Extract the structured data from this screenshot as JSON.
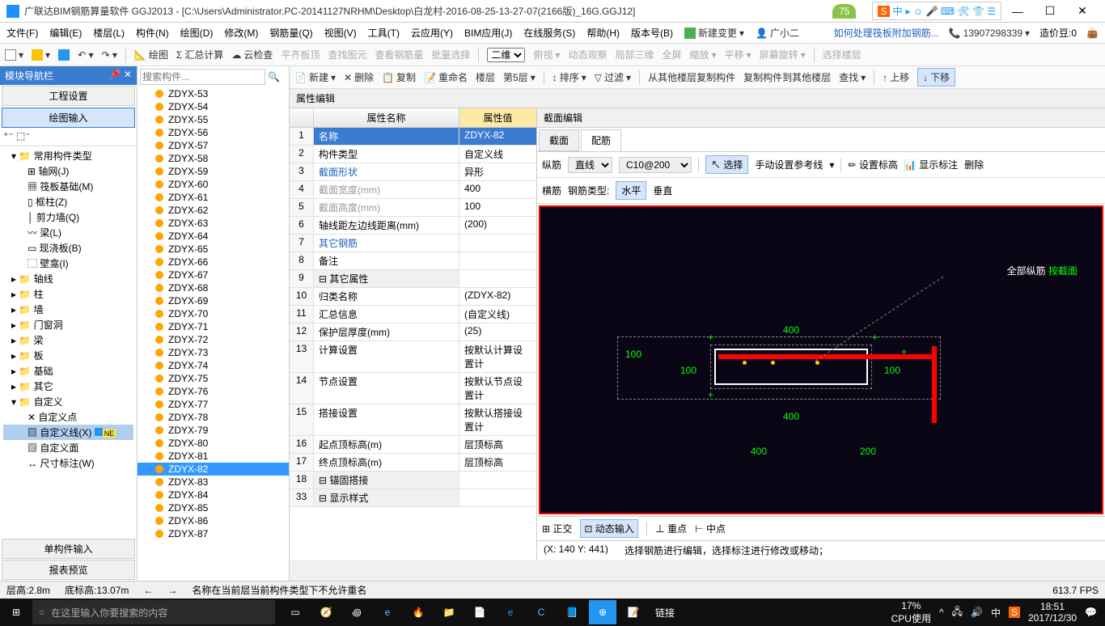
{
  "titlebar": {
    "title": "广联达BIM钢筋算量软件 GGJ2013 - [C:\\Users\\Administrator.PC-20141127NRHM\\Desktop\\白龙村-2016-08-25-13-27-07(2166版)_16G.GGJ12]",
    "badge": "75",
    "ime": "中",
    "min": "—",
    "max": "☐",
    "close": "✕"
  },
  "menu": {
    "items": [
      "文件(F)",
      "编辑(E)",
      "楼层(L)",
      "构件(N)",
      "绘图(D)",
      "修改(M)",
      "钢筋量(Q)",
      "视图(V)",
      "工具(T)",
      "云应用(Y)",
      "BIM应用(J)",
      "在线服务(S)",
      "帮助(H)",
      "版本号(B)"
    ],
    "new_change": "新建变更",
    "user": "广小二",
    "help_link": "如何处理筏板附加钢筋...",
    "phone": "13907298339",
    "coin": "造价豆:0"
  },
  "toolbar": {
    "items": [
      "绘图",
      "汇总计算",
      "云检查",
      "平齐板顶",
      "查找图元",
      "查看钢筋量",
      "批量选择",
      "二维",
      "俯视",
      "动态观察",
      "局部三维",
      "全屏",
      "缩放",
      "平移",
      "屏幕旋转",
      "选择楼层"
    ]
  },
  "toolbar2": {
    "new": "新建",
    "delete": "删除",
    "copy": "复制",
    "rename": "重命名",
    "floor": "楼层",
    "floor_val": "第5层",
    "sort": "排序",
    "filter": "过滤",
    "copy_from": "从其他楼层复制构件",
    "copy_to": "复制构件到其他楼层",
    "lookup": "查找",
    "up": "上移",
    "down": "下移"
  },
  "left_panel": {
    "title": "模块导航栏",
    "btn1": "工程设置",
    "btn2": "绘图输入",
    "cat_common": "常用构件类型",
    "common_items": [
      "轴网(J)",
      "筏板基础(M)",
      "框柱(Z)",
      "剪力墙(Q)",
      "梁(L)",
      "现浇板(B)",
      "壁龛(I)"
    ],
    "cats": [
      "轴线",
      "柱",
      "墙",
      "门窗洞",
      "梁",
      "板",
      "基础",
      "其它",
      "自定义"
    ],
    "custom_items": [
      "自定义点",
      "自定义线(X)",
      "自定义面",
      "尺寸标注(W)"
    ],
    "new_tag": "NE",
    "btn_single": "单构件输入",
    "btn_report": "报表预览"
  },
  "mid": {
    "search_ph": "搜索构件...",
    "items": [
      "ZDYX-53",
      "ZDYX-54",
      "ZDYX-55",
      "ZDYX-56",
      "ZDYX-57",
      "ZDYX-58",
      "ZDYX-59",
      "ZDYX-60",
      "ZDYX-61",
      "ZDYX-62",
      "ZDYX-63",
      "ZDYX-64",
      "ZDYX-65",
      "ZDYX-66",
      "ZDYX-67",
      "ZDYX-68",
      "ZDYX-69",
      "ZDYX-70",
      "ZDYX-71",
      "ZDYX-72",
      "ZDYX-73",
      "ZDYX-74",
      "ZDYX-75",
      "ZDYX-76",
      "ZDYX-77",
      "ZDYX-78",
      "ZDYX-79",
      "ZDYX-80",
      "ZDYX-81",
      "ZDYX-82",
      "ZDYX-83",
      "ZDYX-84",
      "ZDYX-85",
      "ZDYX-86",
      "ZDYX-87"
    ],
    "selected": "ZDYX-82"
  },
  "prop": {
    "title": "属性编辑",
    "head_name": "属性名称",
    "head_val": "属性值",
    "rows": [
      {
        "n": "1",
        "name": "名称",
        "val": "ZDYX-82",
        "sel": true
      },
      {
        "n": "2",
        "name": "构件类型",
        "val": "自定义线"
      },
      {
        "n": "3",
        "name": "截面形状",
        "val": "异形",
        "blue": true
      },
      {
        "n": "4",
        "name": "截面宽度(mm)",
        "val": "400",
        "gray": true
      },
      {
        "n": "5",
        "name": "截面高度(mm)",
        "val": "100",
        "gray": true
      },
      {
        "n": "6",
        "name": "轴线距左边线距离(mm)",
        "val": "(200)"
      },
      {
        "n": "7",
        "name": "其它钢筋",
        "val": "",
        "blue": true
      },
      {
        "n": "8",
        "name": "备注",
        "val": ""
      },
      {
        "n": "9",
        "name": "其它属性",
        "val": "",
        "group": true
      },
      {
        "n": "10",
        "name": "归类名称",
        "val": "(ZDYX-82)"
      },
      {
        "n": "11",
        "name": "汇总信息",
        "val": "(自定义线)"
      },
      {
        "n": "12",
        "name": "保护层厚度(mm)",
        "val": "(25)"
      },
      {
        "n": "13",
        "name": "计算设置",
        "val": "按默认计算设置计"
      },
      {
        "n": "14",
        "name": "节点设置",
        "val": "按默认节点设置计"
      },
      {
        "n": "15",
        "name": "搭接设置",
        "val": "按默认搭接设置计"
      },
      {
        "n": "16",
        "name": "起点顶标高(m)",
        "val": "层顶标高"
      },
      {
        "n": "17",
        "name": "终点顶标高(m)",
        "val": "层顶标高"
      },
      {
        "n": "18",
        "name": "锚固搭接",
        "val": "",
        "group": true
      },
      {
        "n": "33",
        "name": "显示样式",
        "val": "",
        "group": true
      }
    ]
  },
  "section": {
    "title": "截面编辑",
    "tab1": "截面",
    "tab2": "配筋",
    "zongj": "纵筋",
    "line": "直线",
    "rebar": "C10@200",
    "select": "选择",
    "manual": "手动设置参考线",
    "set_mark": "设置标高",
    "show_mark": "显示标注",
    "del": "删除",
    "hengj": "横筋",
    "rebar_type": "钢筋类型:",
    "horiz": "水平",
    "vert": "垂直",
    "all_zongj": "全部纵筋",
    "by_sect": "按截面",
    "dim400": "400",
    "dim100": "100",
    "dim200": "200",
    "ortho": "正交",
    "dynamic": "动态输入",
    "heavy": "重点",
    "mid": "中点",
    "coord": "(X: 140 Y: 441)",
    "hint": "选择钢筋进行编辑，选择标注进行修改或移动；"
  },
  "status": {
    "h": "层高:2.8m",
    "b": "底标高:13.07m",
    "msg": "名称在当前层当前构件类型下不允许重名",
    "fps": "613.7 FPS"
  },
  "taskbar": {
    "search_ph": "在这里输入你要搜索的内容",
    "link": "链接",
    "cpu_pct": "17%",
    "cpu": "CPU使用",
    "time": "18:51",
    "date": "2017/12/30"
  }
}
